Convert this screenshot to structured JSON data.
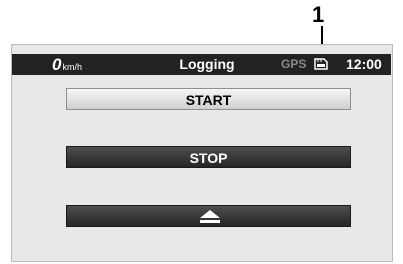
{
  "callout": {
    "number": "1"
  },
  "status_bar": {
    "speed_value": "0",
    "speed_unit": "km/h",
    "title": "Logging",
    "gps_label": "GPS",
    "status_icon": "memory-card-icon",
    "clock": "12:00"
  },
  "buttons": {
    "start_label": "START",
    "stop_label": "STOP",
    "eject_icon": "eject-icon"
  },
  "colors": {
    "status_bar_bg": "#222222",
    "screen_bg": "#e8e8e8",
    "gps_inactive": "#8a8a8a"
  }
}
